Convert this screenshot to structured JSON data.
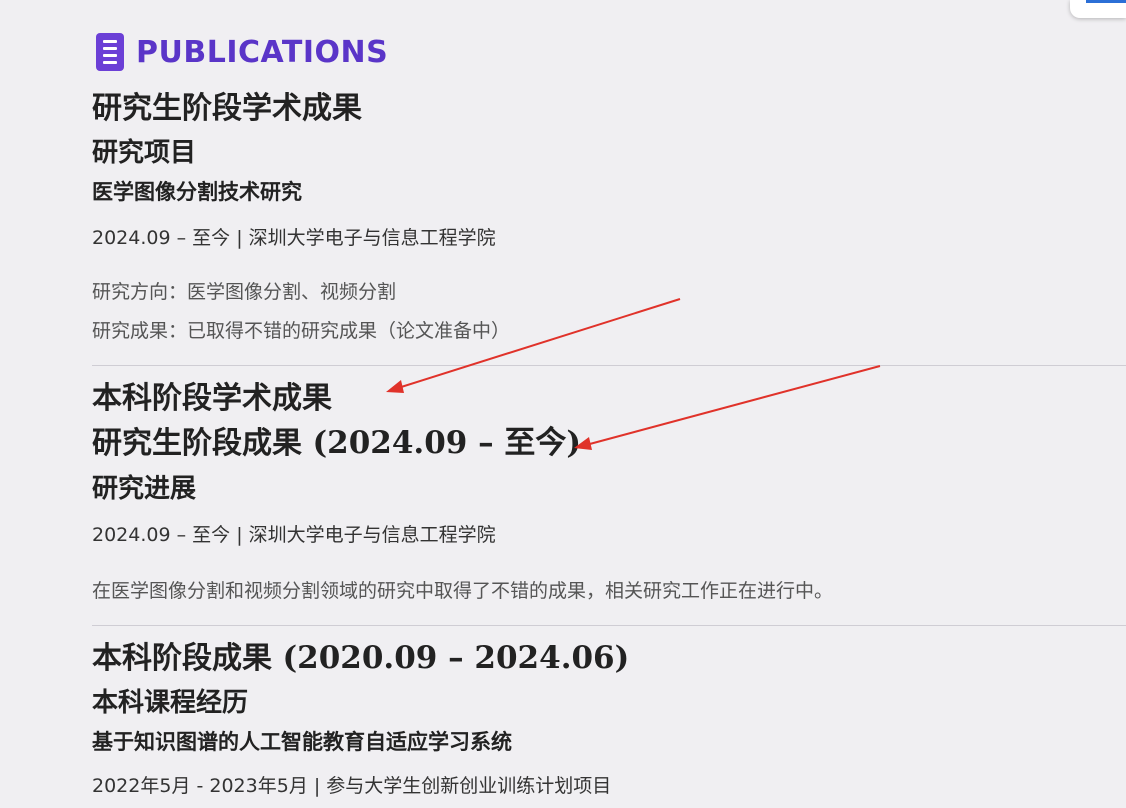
{
  "section": {
    "icon": "document-icon",
    "title": "PUBLICATIONS",
    "accent_color": "#5a35c8"
  },
  "graduate": {
    "heading": "研究生阶段学术成果",
    "projects_heading": "研究项目",
    "project": {
      "title": "医学图像分割技术研究",
      "meta": "2024.09 – 至今 | 深圳大学电子与信息工程学院",
      "lines": [
        "研究方向：医学图像分割、视频分割",
        "研究成果：已取得不错的研究成果（论文准备中）"
      ]
    }
  },
  "undergrad": {
    "heading": "本科阶段学术成果"
  },
  "graduate_results": {
    "heading_main": "研究生阶段成果",
    "heading_paren": "(2024.09 – 至今)",
    "sub_heading": "研究进展",
    "meta": "2024.09 – 至今 | 深圳大学电子与信息工程学院",
    "description": "在医学图像分割和视频分割领域的研究中取得了不错的成果，相关研究工作正在进行中。"
  },
  "undergrad_results": {
    "heading_main": "本科阶段成果",
    "heading_paren": "(2020.09 – 2024.06)",
    "sub_heading": "本科课程经历",
    "project_title": "基于知识图谱的人工智能教育自适应学习系统",
    "meta": "2022年5月 - 2023年5月 | 参与大学生创新创业训练计划项目"
  },
  "annotation": {
    "arrow_color": "#e0322a"
  }
}
